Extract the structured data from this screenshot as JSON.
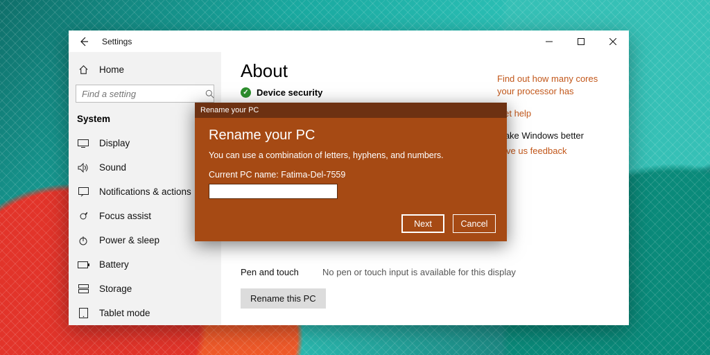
{
  "window": {
    "title": "Settings"
  },
  "sidebar": {
    "home": "Home",
    "search_placeholder": "Find a setting",
    "category": "System",
    "items": [
      {
        "label": "Display"
      },
      {
        "label": "Sound"
      },
      {
        "label": "Notifications & actions"
      },
      {
        "label": "Focus assist"
      },
      {
        "label": "Power & sleep"
      },
      {
        "label": "Battery"
      },
      {
        "label": "Storage"
      },
      {
        "label": "Tablet mode"
      }
    ]
  },
  "content": {
    "page_title": "About",
    "device_security": "Device security"
  },
  "right_links": {
    "cores": "Find out how many cores your processor has",
    "help": "Get help",
    "better_head": "Make Windows better",
    "feedback": "Give us feedback"
  },
  "lower": {
    "pen_label": "Pen and touch",
    "pen_value": "No pen or touch input is available for this display",
    "rename_btn": "Rename this PC"
  },
  "dialog": {
    "titlebar": "Rename your PC",
    "heading": "Rename your PC",
    "desc": "You can use a combination of letters, hyphens, and numbers.",
    "current_label": "Current PC name: Fatima-Del-7559",
    "input_value": "",
    "next": "Next",
    "cancel": "Cancel"
  }
}
